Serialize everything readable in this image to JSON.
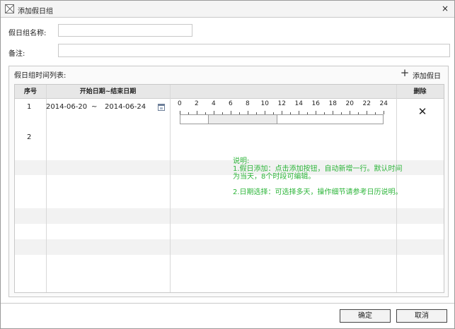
{
  "dialog": {
    "title": "添加假日组",
    "icon": "dialog-window-icon",
    "close_glyph": "×"
  },
  "form": {
    "name_label": "假日组名称:",
    "name_value": "",
    "remark_label": "备注:",
    "remark_value": ""
  },
  "group": {
    "title": "假日组时间列表:",
    "add_label": "添加假日",
    "add_glyph": "+"
  },
  "table": {
    "headers": {
      "index": "序号",
      "date_range": "开始日期~结束日期",
      "time": "",
      "delete": "删除"
    },
    "rows": [
      {
        "index": "1",
        "start_date": "2014-06-20",
        "separator": "~",
        "end_date": "2014-06-24",
        "time_range_hours": [
          3.3,
          11.5
        ],
        "delete_glyph": "✕"
      },
      {
        "index": "2"
      }
    ],
    "time_axis": {
      "min": 0,
      "max": 24,
      "labels": [
        "0",
        "2",
        "4",
        "6",
        "8",
        "10",
        "12",
        "14",
        "16",
        "18",
        "20",
        "22",
        "24"
      ]
    }
  },
  "note": {
    "title": "说明:",
    "line1": "1.假日添加：点击添加按钮，自动新增一行。默认时间为当天，8个时段可编辑。",
    "line2": "2.日期选择：可选择多天，操作细节请参考日历说明。"
  },
  "footer": {
    "ok_label": "确定",
    "cancel_label": "取消"
  },
  "colors": {
    "note_text": "#2db53a",
    "header_bg": "#e7e7e7",
    "alt_row_bg": "#f2f2f2"
  }
}
